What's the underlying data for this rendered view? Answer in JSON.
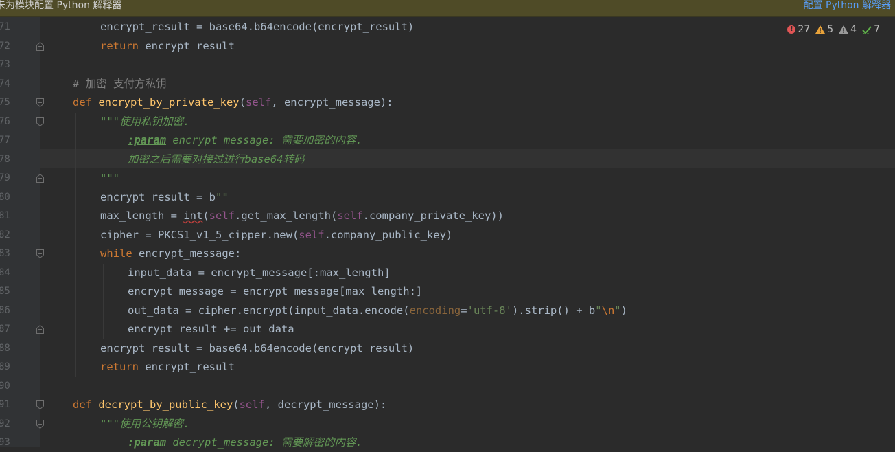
{
  "banner": {
    "message": "未为模块配置 Python 解释器",
    "action": "配置 Python 解释器"
  },
  "inspection": {
    "errors": "27",
    "warnings": "5",
    "weak_warnings": "4",
    "typos": "7"
  },
  "colors": {
    "banner_bg": "#4f4b27",
    "editor_bg": "#2b2b2b",
    "keyword": "#cc7832",
    "function": "#ffc66d",
    "docstring": "#629755",
    "link": "#589df6"
  },
  "lines": [
    {
      "num": "71",
      "parts": [
        [
          "",
          "encrypt_result = base64.b64encode(encrypt_result)"
        ]
      ]
    },
    {
      "num": "72",
      "parts": [
        [
          "kw",
          "return"
        ],
        [
          "",
          " encrypt_result"
        ]
      ]
    },
    {
      "num": "73",
      "parts": []
    },
    {
      "num": "74",
      "parts": [
        [
          "cm",
          "# 加密 支付方私钥"
        ]
      ]
    },
    {
      "num": "75",
      "parts": [
        [
          "kw",
          "def "
        ],
        [
          "fn",
          "encrypt_by_private_key"
        ],
        [
          "",
          "("
        ],
        [
          "self",
          "self"
        ],
        [
          "",
          ", encrypt_message):"
        ]
      ]
    },
    {
      "num": "76",
      "parts": [
        [
          "doc",
          "\"\"\"使用私钥加密."
        ]
      ]
    },
    {
      "num": "77",
      "parts": [
        [
          "tag",
          ":param"
        ],
        [
          "doc",
          " encrypt_message: 需要加密的内容."
        ]
      ]
    },
    {
      "num": "78",
      "parts": [
        [
          "doc",
          "加密之后需要对接过进行base64转码"
        ]
      ]
    },
    {
      "num": "79",
      "parts": [
        [
          "doc",
          "\"\"\""
        ]
      ]
    },
    {
      "num": "80",
      "parts": [
        [
          "",
          "encrypt_result = b"
        ],
        [
          "str",
          "\"\""
        ]
      ]
    },
    {
      "num": "81",
      "parts": [
        [
          "",
          "max_length = "
        ],
        [
          "squig",
          "int"
        ],
        [
          "",
          "("
        ],
        [
          "self",
          "self"
        ],
        [
          "",
          ".get_max_length("
        ],
        [
          "self",
          "self"
        ],
        [
          "",
          ".company_private_key))"
        ]
      ]
    },
    {
      "num": "82",
      "parts": [
        [
          "",
          "cipher = PKCS1_v1_5_cipper.new("
        ],
        [
          "self",
          "self"
        ],
        [
          "",
          ".company_public_key)"
        ]
      ]
    },
    {
      "num": "83",
      "parts": [
        [
          "kw",
          "while"
        ],
        [
          "",
          " encrypt_message:"
        ]
      ]
    },
    {
      "num": "84",
      "parts": [
        [
          "",
          "input_data = encrypt_message[:max_length]"
        ]
      ]
    },
    {
      "num": "85",
      "parts": [
        [
          "",
          "encrypt_message = encrypt_message[max_length:]"
        ]
      ]
    },
    {
      "num": "86",
      "parts": [
        [
          "",
          "out_data = cipher.encrypt(input_data.encode("
        ],
        [
          "param",
          "encoding"
        ],
        [
          "",
          "="
        ],
        [
          "str",
          "'utf-8'"
        ],
        [
          "",
          ").strip() + b"
        ],
        [
          "str",
          "\""
        ],
        [
          "esc",
          "\\n"
        ],
        [
          "str",
          "\""
        ],
        [
          "",
          ")"
        ]
      ]
    },
    {
      "num": "87",
      "parts": [
        [
          "",
          "encrypt_result += out_data"
        ]
      ]
    },
    {
      "num": "88",
      "parts": [
        [
          "",
          "encrypt_result = base64.b64encode(encrypt_result)"
        ]
      ]
    },
    {
      "num": "89",
      "parts": [
        [
          "kw",
          "return"
        ],
        [
          "",
          " encrypt_result"
        ]
      ]
    },
    {
      "num": "90",
      "parts": []
    },
    {
      "num": "91",
      "parts": [
        [
          "kw",
          "def "
        ],
        [
          "fn",
          "decrypt_by_public_key"
        ],
        [
          "",
          "("
        ],
        [
          "self",
          "self"
        ],
        [
          "",
          ", decrypt_message):"
        ]
      ]
    },
    {
      "num": "92",
      "parts": [
        [
          "doc",
          "\"\"\"使用公钥解密."
        ]
      ]
    },
    {
      "num": "93",
      "parts": [
        [
          "tag",
          ":param"
        ],
        [
          "doc",
          " decrypt_message: 需要解密的内容."
        ]
      ]
    }
  ]
}
